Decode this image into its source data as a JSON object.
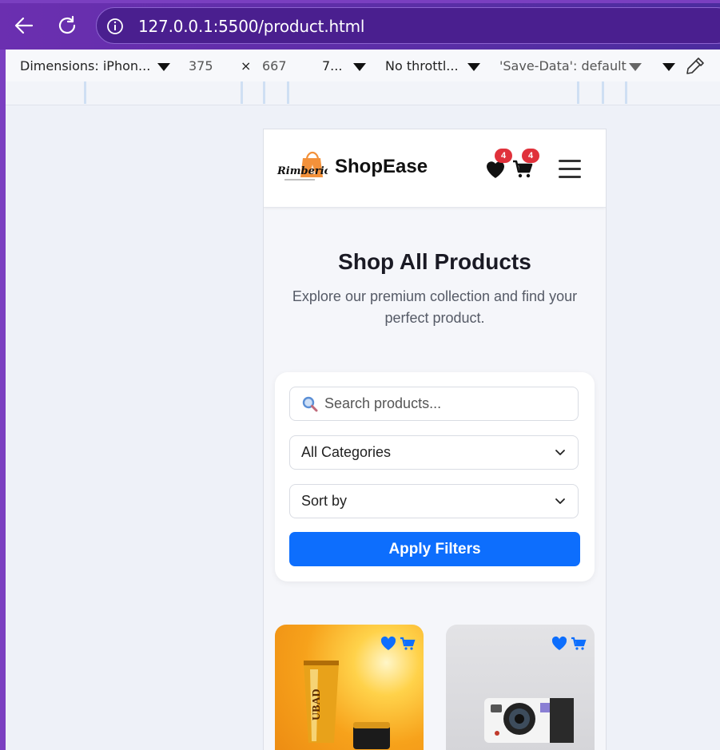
{
  "browser": {
    "url": "127.0.0.1:5500/product.html"
  },
  "devtools": {
    "dimensions_label": "Dimensions: iPhon...",
    "width": "375",
    "times": "×",
    "height": "667",
    "zoom": "7...",
    "throttle": "No throttl...",
    "save_data": "'Save-Data': default"
  },
  "site": {
    "logo_text": "Rimberio",
    "brand": "ShopEase",
    "wishlist_count": "4",
    "cart_count": "4"
  },
  "hero": {
    "title": "Shop All Products",
    "subtitle": "Explore our premium collection and find your perfect product."
  },
  "filters": {
    "search_placeholder": "Search products...",
    "category_selected": "All Categories",
    "sort_selected": "Sort by",
    "apply_label": "Apply Filters"
  },
  "products": [
    {
      "image": "cream-tube-product-image",
      "product_label": "UBAD"
    },
    {
      "image": "instant-camera-product-image"
    }
  ],
  "colors": {
    "primary": "#0d6efd",
    "badge": "#e0313b",
    "browser_purple": "#5a2ea6"
  }
}
